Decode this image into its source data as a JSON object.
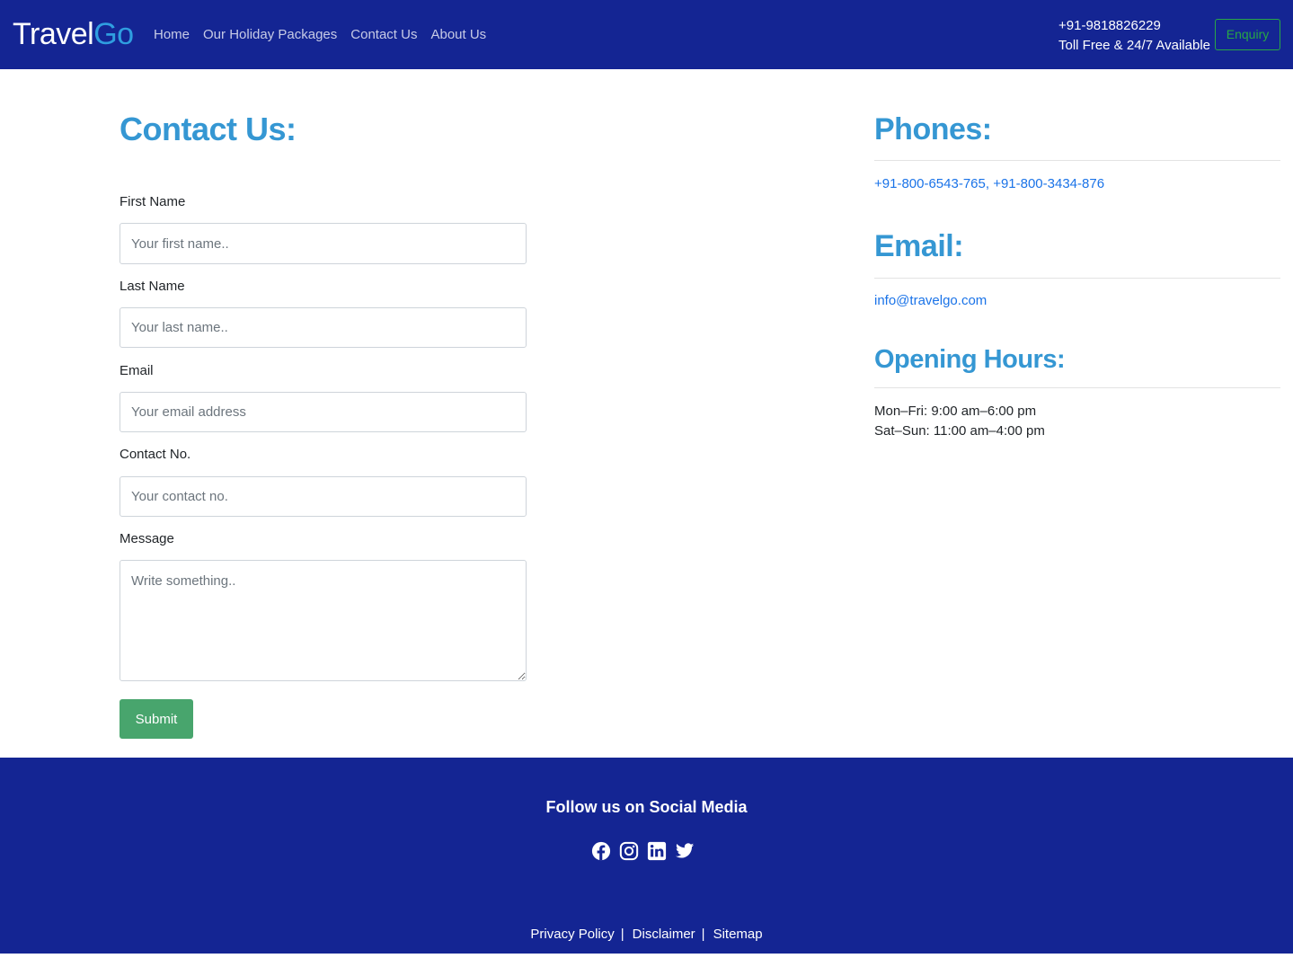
{
  "header": {
    "brand_part1": "Travel",
    "brand_part2": "Go",
    "nav": [
      "Home",
      "Our Holiday Packages",
      "Contact Us",
      "About Us"
    ],
    "phone": "+91-9818826229",
    "availability": "Toll Free & 24/7 Available",
    "enquiry_label": "Enquiry"
  },
  "form": {
    "title": "Contact Us:",
    "first_name_label": "First Name",
    "first_name_placeholder": "Your first name..",
    "last_name_label": "Last Name",
    "last_name_placeholder": "Your last name..",
    "email_label": "Email",
    "email_placeholder": "Your email address",
    "contact_label": "Contact No.",
    "contact_placeholder": "Your contact no.",
    "message_label": "Message",
    "message_placeholder": "Write something..",
    "submit_label": "Submit"
  },
  "info": {
    "phones_title": "Phones:",
    "phones_value": "+91-800-6543-765, +91-800-3434-876",
    "email_title": "Email:",
    "email_value": "info@travelgo.com",
    "hours_title": "Opening Hours:",
    "hours_weekday": "Mon–Fri: 9:00 am–6:00 pm",
    "hours_weekend": "Sat–Sun: 11:00 am–4:00 pm"
  },
  "footer": {
    "follow": "Follow us on Social Media",
    "socials": [
      "facebook-icon",
      "instagram-icon",
      "linkedin-icon",
      "twitter-icon"
    ],
    "links": [
      "Privacy Policy",
      "Disclaimer",
      "Sitemap"
    ],
    "separator": "|"
  },
  "colors": {
    "navy": "#142593",
    "heading_blue": "#3597d3",
    "link_blue": "#1a73e8",
    "submit_green": "#48a56d",
    "enquiry_green": "#28a745"
  }
}
